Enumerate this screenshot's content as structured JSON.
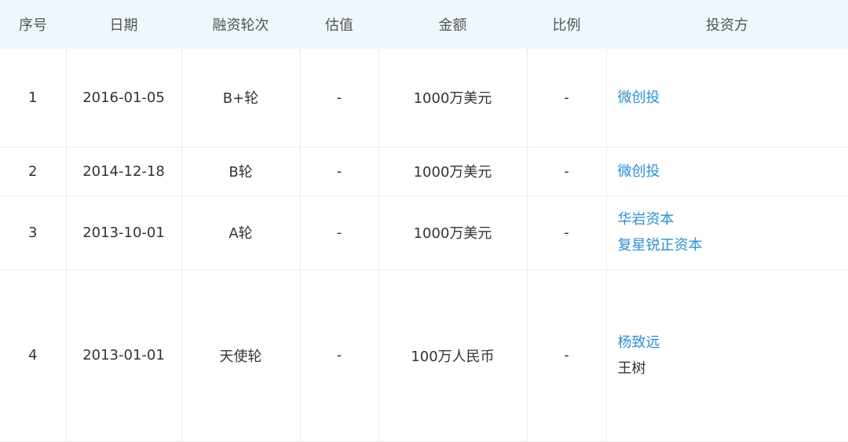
{
  "headers": {
    "index": "序号",
    "date": "日期",
    "round": "融资轮次",
    "valuation": "估值",
    "amount": "金额",
    "ratio": "比例",
    "investors": "投资方"
  },
  "rows": [
    {
      "index": "1",
      "date": "2016-01-05",
      "round": "B+轮",
      "valuation": "-",
      "amount": "1000万美元",
      "ratio": "-",
      "investors": [
        {
          "name": "微创投",
          "linked": true
        }
      ]
    },
    {
      "index": "2",
      "date": "2014-12-18",
      "round": "B轮",
      "valuation": "-",
      "amount": "1000万美元",
      "ratio": "-",
      "investors": [
        {
          "name": "微创投",
          "linked": true
        }
      ]
    },
    {
      "index": "3",
      "date": "2013-10-01",
      "round": "A轮",
      "valuation": "-",
      "amount": "1000万美元",
      "ratio": "-",
      "investors": [
        {
          "name": "华岩资本",
          "linked": true
        },
        {
          "name": "复星锐正资本",
          "linked": true
        }
      ]
    },
    {
      "index": "4",
      "date": "2013-01-01",
      "round": "天使轮",
      "valuation": "-",
      "amount": "100万人民币",
      "ratio": "-",
      "investors": [
        {
          "name": "杨致远",
          "linked": true
        },
        {
          "name": "王树",
          "linked": false
        }
      ]
    }
  ],
  "colors": {
    "header_bg": "#eef7fb",
    "link": "#2d8fd6",
    "text": "#333333",
    "border": "#e8eef3"
  }
}
